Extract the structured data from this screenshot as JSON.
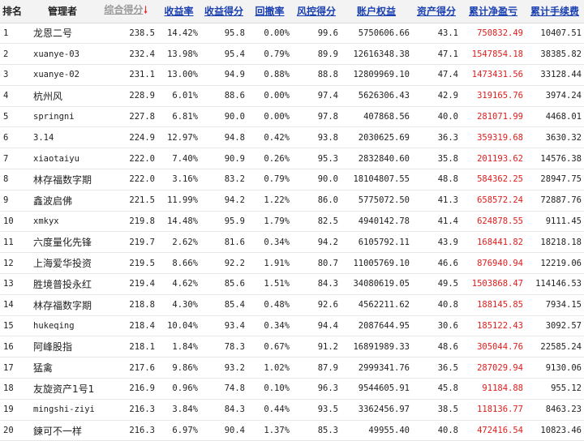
{
  "headers": {
    "rank": "排名",
    "manager": "管理者",
    "composite": "综合得分",
    "return_rate": "收益率",
    "return_score": "收益得分",
    "drawdown": "回撤率",
    "risk_score": "风控得分",
    "equity": "账户权益",
    "asset_score": "资产得分",
    "pnl": "累计净盈亏",
    "fees": "累计手续费"
  },
  "sort": {
    "column": "composite",
    "direction": "desc",
    "icon": "arrow-down-icon",
    "icon_color": "#e52b2b"
  },
  "colors": {
    "header_link": "#1a3fb0",
    "sorted_header": "#9a9a9a",
    "pnl_positive": "#e01c1c"
  },
  "rows": [
    {
      "rank": "1",
      "manager": "龙恩二号",
      "composite": "238.5",
      "return_rate": "14.42%",
      "return_score": "95.8",
      "drawdown": "0.00%",
      "risk_score": "99.6",
      "equity": "5750606.66",
      "asset_score": "43.1",
      "pnl": "750832.49",
      "fees": "10407.51"
    },
    {
      "rank": "2",
      "manager": "xuanye-03",
      "composite": "232.4",
      "return_rate": "13.98%",
      "return_score": "95.4",
      "drawdown": "0.79%",
      "risk_score": "89.9",
      "equity": "12616348.38",
      "asset_score": "47.1",
      "pnl": "1547854.18",
      "fees": "38385.82"
    },
    {
      "rank": "3",
      "manager": "xuanye-02",
      "composite": "231.1",
      "return_rate": "13.00%",
      "return_score": "94.9",
      "drawdown": "0.88%",
      "risk_score": "88.8",
      "equity": "12809969.10",
      "asset_score": "47.4",
      "pnl": "1473431.56",
      "fees": "33128.44"
    },
    {
      "rank": "4",
      "manager": "杭州风",
      "composite": "228.9",
      "return_rate": "6.01%",
      "return_score": "88.6",
      "drawdown": "0.00%",
      "risk_score": "97.4",
      "equity": "5626306.43",
      "asset_score": "42.9",
      "pnl": "319165.76",
      "fees": "3974.24"
    },
    {
      "rank": "5",
      "manager": "springni",
      "composite": "227.8",
      "return_rate": "6.81%",
      "return_score": "90.0",
      "drawdown": "0.00%",
      "risk_score": "97.8",
      "equity": "407868.56",
      "asset_score": "40.0",
      "pnl": "281071.99",
      "fees": "4468.01"
    },
    {
      "rank": "6",
      "manager": "3.14",
      "composite": "224.9",
      "return_rate": "12.97%",
      "return_score": "94.8",
      "drawdown": "0.42%",
      "risk_score": "93.8",
      "equity": "2030625.69",
      "asset_score": "36.3",
      "pnl": "359319.68",
      "fees": "3630.32"
    },
    {
      "rank": "7",
      "manager": "xiaotaiyu",
      "composite": "222.0",
      "return_rate": "7.40%",
      "return_score": "90.9",
      "drawdown": "0.26%",
      "risk_score": "95.3",
      "equity": "2832840.60",
      "asset_score": "35.8",
      "pnl": "201193.62",
      "fees": "14576.38"
    },
    {
      "rank": "8",
      "manager": "林存福数字期",
      "composite": "222.0",
      "return_rate": "3.16%",
      "return_score": "83.2",
      "drawdown": "0.79%",
      "risk_score": "90.0",
      "equity": "18104807.55",
      "asset_score": "48.8",
      "pnl": "584362.25",
      "fees": "28947.75"
    },
    {
      "rank": "9",
      "manager": "鑫波启佛",
      "composite": "221.5",
      "return_rate": "11.99%",
      "return_score": "94.2",
      "drawdown": "1.22%",
      "risk_score": "86.0",
      "equity": "5775072.50",
      "asset_score": "41.3",
      "pnl": "658572.24",
      "fees": "72887.76"
    },
    {
      "rank": "10",
      "manager": "xmkyx",
      "composite": "219.8",
      "return_rate": "14.48%",
      "return_score": "95.9",
      "drawdown": "1.79%",
      "risk_score": "82.5",
      "equity": "4940142.78",
      "asset_score": "41.4",
      "pnl": "624878.55",
      "fees": "9111.45"
    },
    {
      "rank": "11",
      "manager": "六度量化先锋",
      "composite": "219.7",
      "return_rate": "2.62%",
      "return_score": "81.6",
      "drawdown": "0.34%",
      "risk_score": "94.2",
      "equity": "6105792.11",
      "asset_score": "43.9",
      "pnl": "168441.82",
      "fees": "18218.18"
    },
    {
      "rank": "12",
      "manager": "上海爱华投资",
      "composite": "219.5",
      "return_rate": "8.66%",
      "return_score": "92.2",
      "drawdown": "1.91%",
      "risk_score": "80.7",
      "equity": "11005769.10",
      "asset_score": "46.6",
      "pnl": "876940.94",
      "fees": "12219.06"
    },
    {
      "rank": "13",
      "manager": "胜境普投永红",
      "composite": "219.4",
      "return_rate": "4.62%",
      "return_score": "85.6",
      "drawdown": "1.51%",
      "risk_score": "84.3",
      "equity": "34080619.05",
      "asset_score": "49.5",
      "pnl": "1503868.47",
      "fees": "114146.53"
    },
    {
      "rank": "14",
      "manager": "林存福数字期",
      "composite": "218.8",
      "return_rate": "4.30%",
      "return_score": "85.4",
      "drawdown": "0.48%",
      "risk_score": "92.6",
      "equity": "4562211.62",
      "asset_score": "40.8",
      "pnl": "188145.85",
      "fees": "7934.15"
    },
    {
      "rank": "15",
      "manager": "hukeqing",
      "composite": "218.4",
      "return_rate": "10.04%",
      "return_score": "93.4",
      "drawdown": "0.34%",
      "risk_score": "94.4",
      "equity": "2087644.95",
      "asset_score": "30.6",
      "pnl": "185122.43",
      "fees": "3092.57"
    },
    {
      "rank": "16",
      "manager": "阿峰股指",
      "composite": "218.1",
      "return_rate": "1.84%",
      "return_score": "78.3",
      "drawdown": "0.67%",
      "risk_score": "91.2",
      "equity": "16891989.33",
      "asset_score": "48.6",
      "pnl": "305044.76",
      "fees": "22585.24"
    },
    {
      "rank": "17",
      "manager": "猛禽",
      "composite": "217.6",
      "return_rate": "9.86%",
      "return_score": "93.2",
      "drawdown": "1.02%",
      "risk_score": "87.9",
      "equity": "2999341.76",
      "asset_score": "36.5",
      "pnl": "287029.94",
      "fees": "9130.06"
    },
    {
      "rank": "18",
      "manager": "友旋资产1号1",
      "composite": "216.9",
      "return_rate": "0.96%",
      "return_score": "74.8",
      "drawdown": "0.10%",
      "risk_score": "96.3",
      "equity": "9544605.91",
      "asset_score": "45.8",
      "pnl": "91184.88",
      "fees": "955.12"
    },
    {
      "rank": "19",
      "manager": "mingshi-ziyi",
      "composite": "216.3",
      "return_rate": "3.84%",
      "return_score": "84.3",
      "drawdown": "0.44%",
      "risk_score": "93.5",
      "equity": "3362456.97",
      "asset_score": "38.5",
      "pnl": "118136.77",
      "fees": "8463.23"
    },
    {
      "rank": "20",
      "manager": "鍊可不一样",
      "composite": "216.3",
      "return_rate": "6.97%",
      "return_score": "90.4",
      "drawdown": "1.37%",
      "risk_score": "85.3",
      "equity": "49955.40",
      "asset_score": "40.8",
      "pnl": "472416.54",
      "fees": "10823.46"
    }
  ]
}
